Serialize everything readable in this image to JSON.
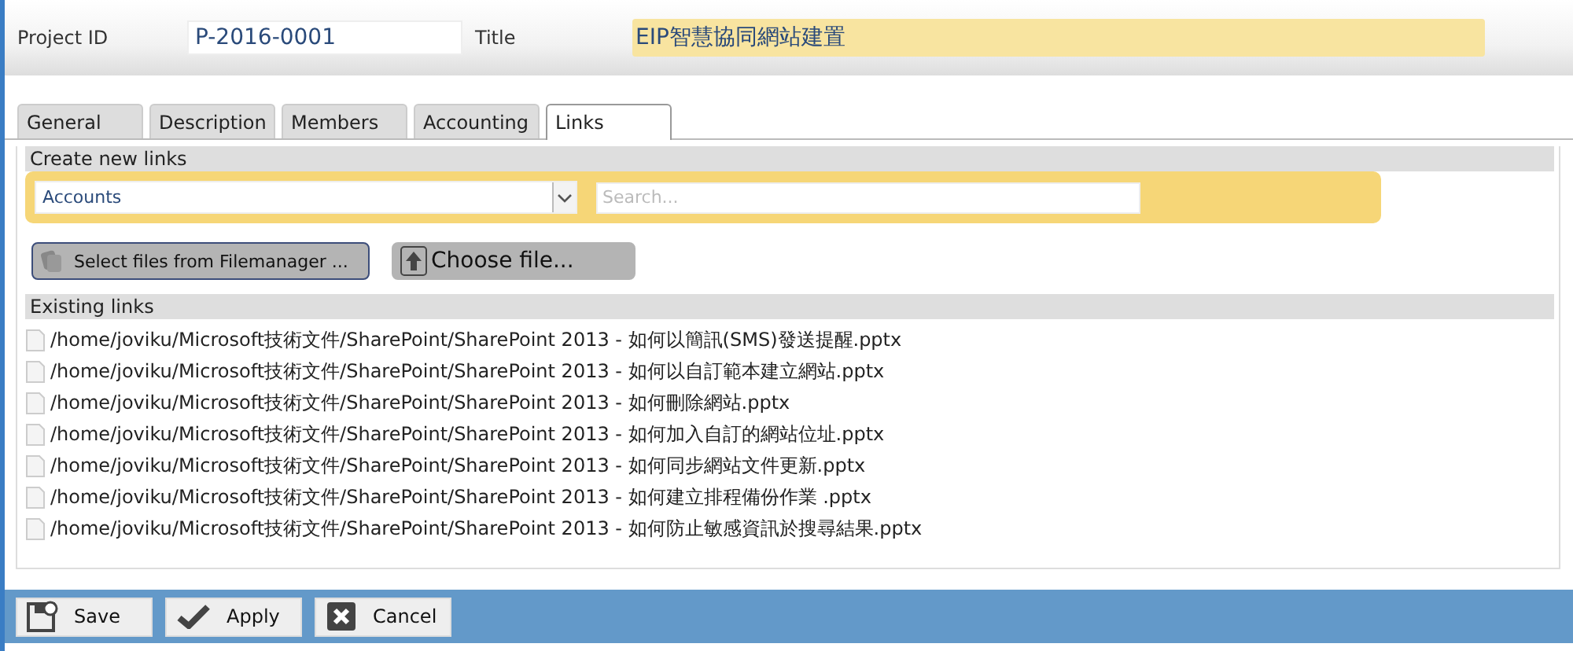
{
  "header": {
    "project_id_label": "Project ID",
    "project_id": "P-2016-0001",
    "title_label": "Title",
    "title": "EIP智慧協同網站建置"
  },
  "tabs": [
    {
      "label": "General",
      "selected": false
    },
    {
      "label": "Description",
      "selected": false
    },
    {
      "label": "Members",
      "selected": false
    },
    {
      "label": "Accounting",
      "selected": false
    },
    {
      "label": "Links",
      "selected": true
    }
  ],
  "create_section": {
    "heading": "Create new links",
    "select_value": "Accounts",
    "search_placeholder": "Search...",
    "buttons": [
      {
        "label": "Select files from Filemanager ...",
        "kind": "filemanager"
      },
      {
        "label": "Choose file...",
        "kind": "upload"
      }
    ]
  },
  "existing_section": {
    "heading": "Existing links",
    "links": [
      "/home/joviku/Microsoft技術文件/SharePoint/SharePoint 2013 - 如何以簡訊(SMS)發送提醒.pptx",
      "/home/joviku/Microsoft技術文件/SharePoint/SharePoint 2013 - 如何以自訂範本建立網站.pptx",
      "/home/joviku/Microsoft技術文件/SharePoint/SharePoint 2013 - 如何刪除網站.pptx",
      "/home/joviku/Microsoft技術文件/SharePoint/SharePoint 2013 - 如何加入自訂的網站位址.pptx",
      "/home/joviku/Microsoft技術文件/SharePoint/SharePoint 2013 - 如何同步網站文件更新.pptx",
      "/home/joviku/Microsoft技術文件/SharePoint/SharePoint 2013 - 如何建立排程備份作業 .pptx",
      "/home/joviku/Microsoft技術文件/SharePoint/SharePoint 2013 - 如何防止敏感資訊於搜尋結果.pptx"
    ]
  },
  "footer_buttons": [
    {
      "label": "Save",
      "kind": "save"
    },
    {
      "label": "Apply",
      "kind": "apply"
    },
    {
      "label": "Cancel",
      "kind": "cancel"
    }
  ]
}
